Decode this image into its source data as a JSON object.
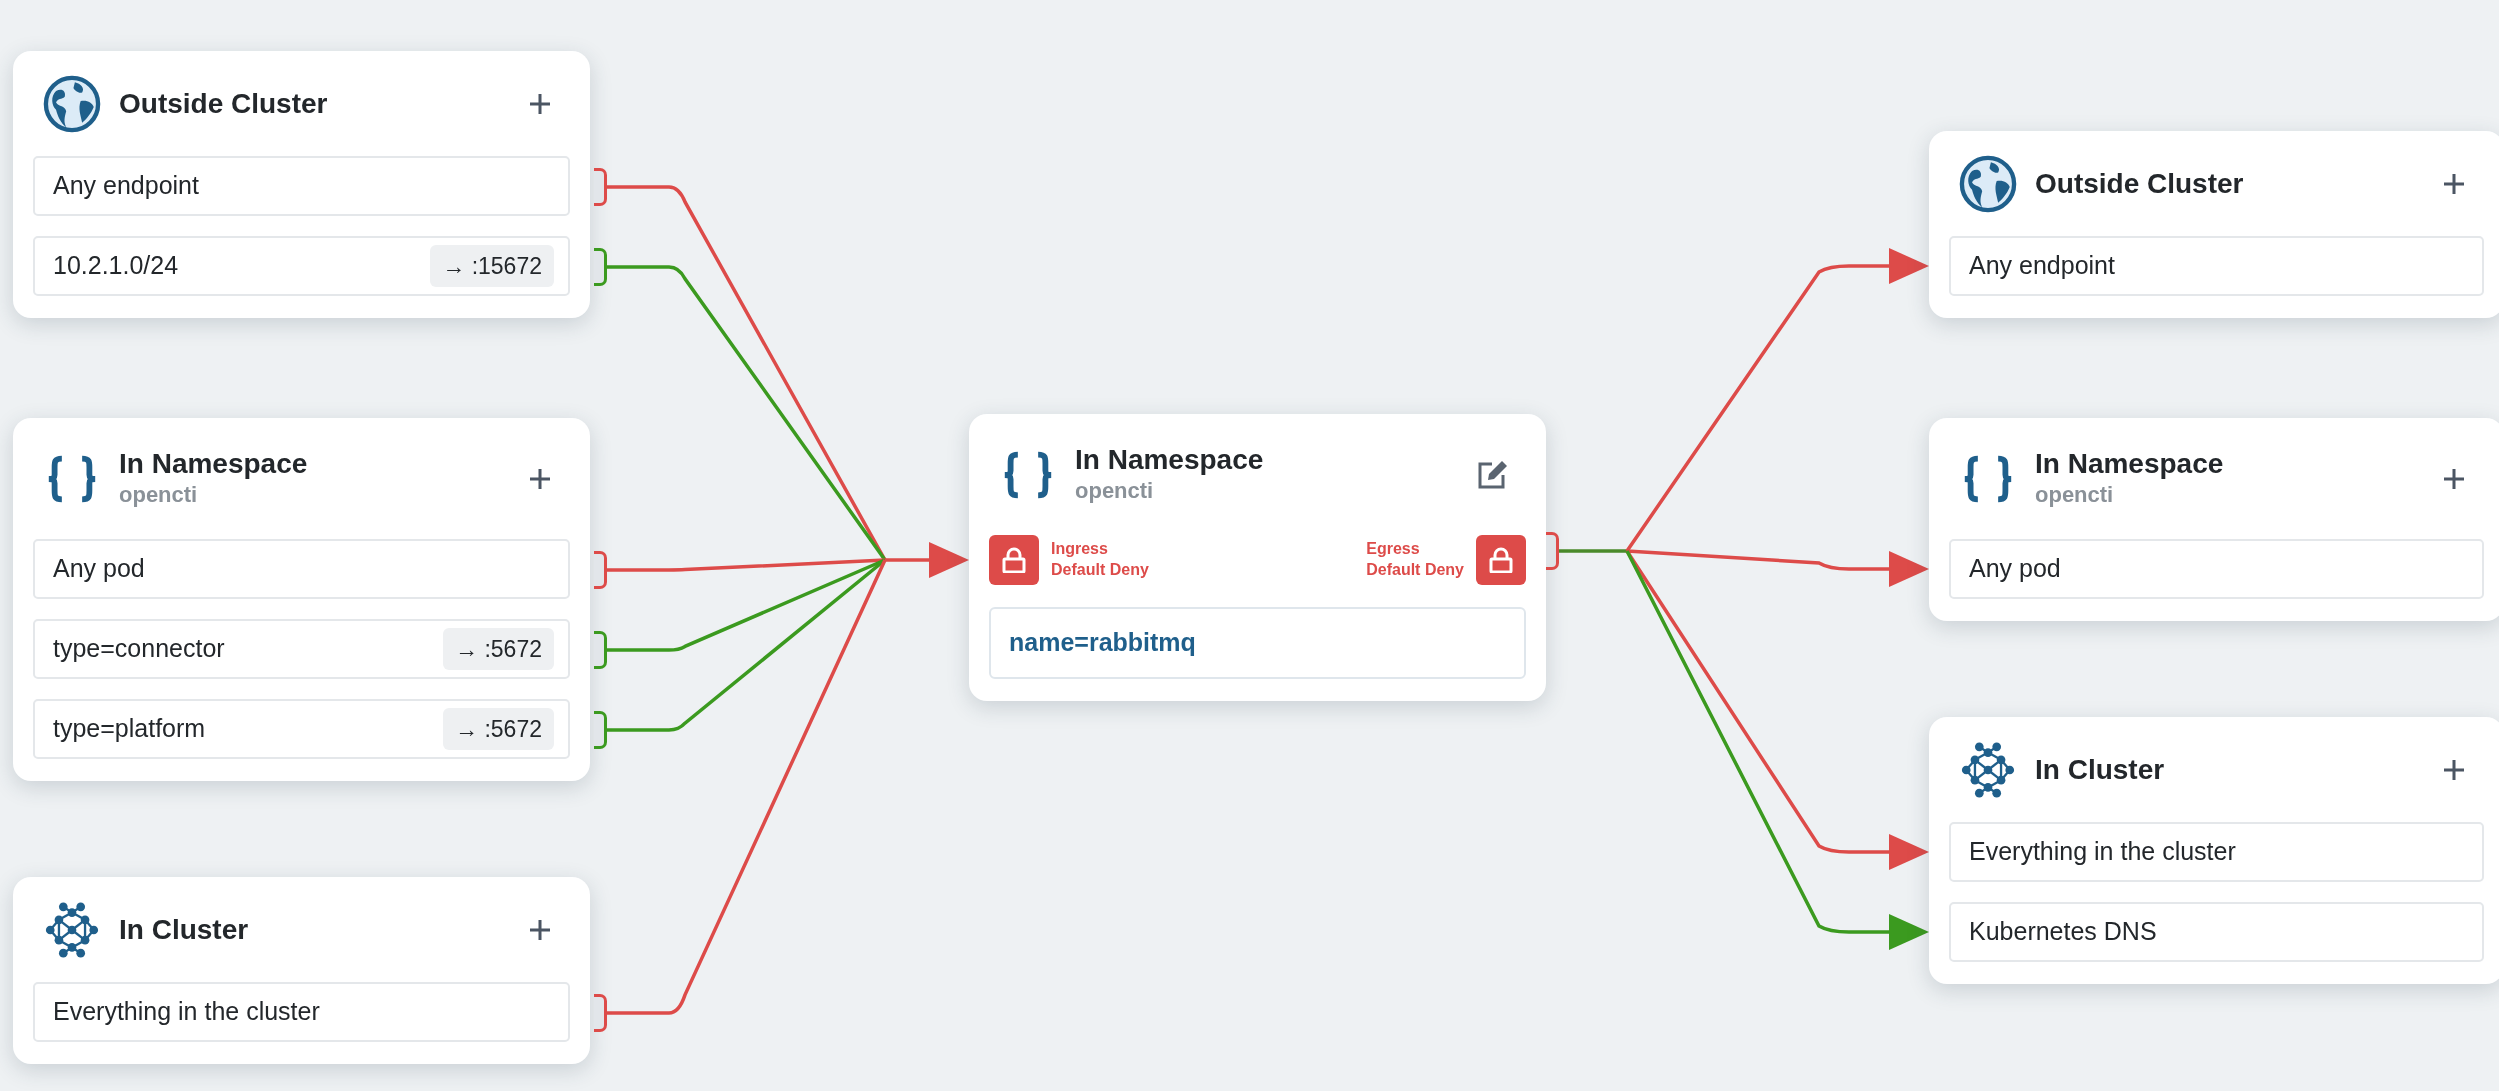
{
  "left_nodes": [
    {
      "kind": "outside",
      "title": "Outside Cluster",
      "action": {
        "kind": "add"
      },
      "items": [
        {
          "label": "Any endpoint",
          "kind": "deny"
        },
        {
          "label": "10.2.1.0/24",
          "port": "→ :15672",
          "kind": "allow"
        }
      ]
    },
    {
      "kind": "namespace",
      "title": "In Namespace",
      "subtitle": "opencti",
      "action": {
        "kind": "add"
      },
      "items": [
        {
          "label": "Any pod",
          "kind": "deny"
        },
        {
          "label": "type=connector",
          "port": "→ :5672",
          "kind": "allow"
        },
        {
          "label": "type=platform",
          "port": "→ :5672",
          "kind": "allow"
        }
      ]
    },
    {
      "kind": "cluster",
      "title": "In Cluster",
      "action": {
        "kind": "add"
      },
      "items": [
        {
          "label": "Everything in the cluster",
          "kind": "deny"
        }
      ]
    }
  ],
  "center_node": {
    "kind": "namespace",
    "title": "In Namespace",
    "subtitle": "opencti",
    "action": {
      "kind": "edit"
    },
    "ingress": {
      "lines": [
        "Ingress",
        "Default Deny"
      ],
      "default_deny": true
    },
    "egress": {
      "lines": [
        "Egress",
        "Default Deny"
      ],
      "default_deny": true
    },
    "selector": "name=rabbitmq"
  },
  "right_nodes": [
    {
      "kind": "outside",
      "title": "Outside Cluster",
      "action": {
        "kind": "add"
      },
      "items": [
        {
          "label": "Any endpoint",
          "kind": "deny"
        }
      ]
    },
    {
      "kind": "namespace",
      "title": "In Namespace",
      "subtitle": "opencti",
      "action": {
        "kind": "add"
      },
      "items": [
        {
          "label": "Any pod",
          "kind": "deny"
        }
      ]
    },
    {
      "kind": "cluster",
      "title": "In Cluster",
      "action": {
        "kind": "add"
      },
      "items": [
        {
          "label": "Everything in the cluster",
          "kind": "deny"
        },
        {
          "label": "Kubernetes DNS",
          "kind": "allow"
        }
      ]
    }
  ]
}
